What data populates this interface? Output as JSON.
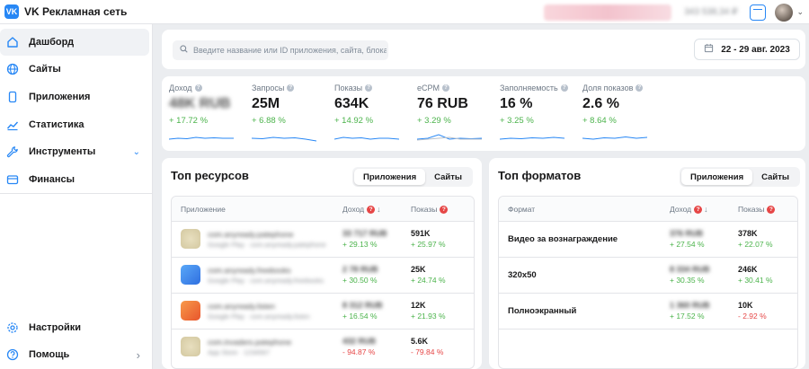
{
  "app": {
    "logo_mark": "VK",
    "title": "VK Рекламная сеть"
  },
  "topbar": {
    "balance": "343 538,34 ₽",
    "user_chevron": "⌄"
  },
  "sidebar": {
    "items": [
      {
        "label": "Дашборд",
        "icon": "home-icon"
      },
      {
        "label": "Сайты",
        "icon": "globe-icon"
      },
      {
        "label": "Приложения",
        "icon": "phone-icon"
      },
      {
        "label": "Статистика",
        "icon": "chart-icon"
      },
      {
        "label": "Инструменты",
        "icon": "wrench-icon",
        "chevron": "⌄"
      },
      {
        "label": "Финансы",
        "icon": "wallet-icon"
      }
    ],
    "bottom": [
      {
        "label": "Настройки",
        "icon": "gear-icon"
      },
      {
        "label": "Помощь",
        "icon": "help-icon",
        "chevron": "›"
      }
    ]
  },
  "search": {
    "placeholder": "Введите название или ID приложения, сайта, блока"
  },
  "date_range": {
    "label": "22 - 29 авг. 2023"
  },
  "metrics": [
    {
      "title": "Доход",
      "value": "48K RUB",
      "delta": "+ 17.72 %"
    },
    {
      "title": "Запросы",
      "value": "25M",
      "delta": "+ 6.88 %"
    },
    {
      "title": "Показы",
      "value": "634K",
      "delta": "+ 14.92 %"
    },
    {
      "title": "eCPM",
      "value": "76 RUB",
      "delta": "+ 3.29 %"
    },
    {
      "title": "Заполняемость",
      "value": "16 %",
      "delta": "+ 3.25 %"
    },
    {
      "title": "Доля показов",
      "value": "2.6 %",
      "delta": "+ 8.64 %"
    }
  ],
  "top_resources": {
    "title": "Топ ресурсов",
    "tabs": [
      "Приложения",
      "Сайты"
    ],
    "columns": [
      "Приложение",
      "Доход",
      "Показы"
    ],
    "rows": [
      {
        "name": "com.anyready.patephone",
        "sub": "Google Play · com.anyready.patephone",
        "income": "33 717 RUB",
        "income_delta": "+ 29.13 %",
        "shows": "591K",
        "shows_delta": "+ 25.97 %",
        "icon_color": "#d9cfa8"
      },
      {
        "name": "com.anyready.freebooks",
        "sub": "Google Play · com.anyready.freebooks",
        "income": "2 78 RUB",
        "income_delta": "+ 30.50 %",
        "shows": "25K",
        "shows_delta": "+ 24.74 %",
        "icon_color": "#3f8ef0"
      },
      {
        "name": "com.anyready.listen",
        "sub": "Google Play · com.anyready.listen",
        "income": "8 312 RUB",
        "income_delta": "+ 16.54 %",
        "shows": "12K",
        "shows_delta": "+ 21.93 %",
        "icon_color": "#f06a3b"
      },
      {
        "name": "com.invaders.patephone",
        "sub": "App Store · 1234567",
        "income": "432 RUB",
        "income_delta": "- 94.87 %",
        "shows": "5.6K",
        "shows_delta": "- 79.84 %",
        "icon_color": "#d9cfa8"
      }
    ]
  },
  "top_formats": {
    "title": "Топ форматов",
    "tabs": [
      "Приложения",
      "Сайты"
    ],
    "columns": [
      "Формат",
      "Доход",
      "Показы"
    ],
    "rows": [
      {
        "name": "Видео за вознаграждение",
        "income": "376 RUB",
        "income_delta": "+ 27.54 %",
        "shows": "378K",
        "shows_delta": "+ 22.07 %"
      },
      {
        "name": "320x50",
        "income": "8 334 RUB",
        "income_delta": "+ 30.35 %",
        "shows": "246K",
        "shows_delta": "+ 30.41 %"
      },
      {
        "name": "Полноэкранный",
        "income": "1 360 RUB",
        "income_delta": "+ 17.52 %",
        "shows": "10K",
        "shows_delta": "- 2.92 %"
      }
    ]
  },
  "colors": {
    "accent": "#2787f5",
    "positive": "#4bb34b",
    "negative": "#e64646"
  }
}
